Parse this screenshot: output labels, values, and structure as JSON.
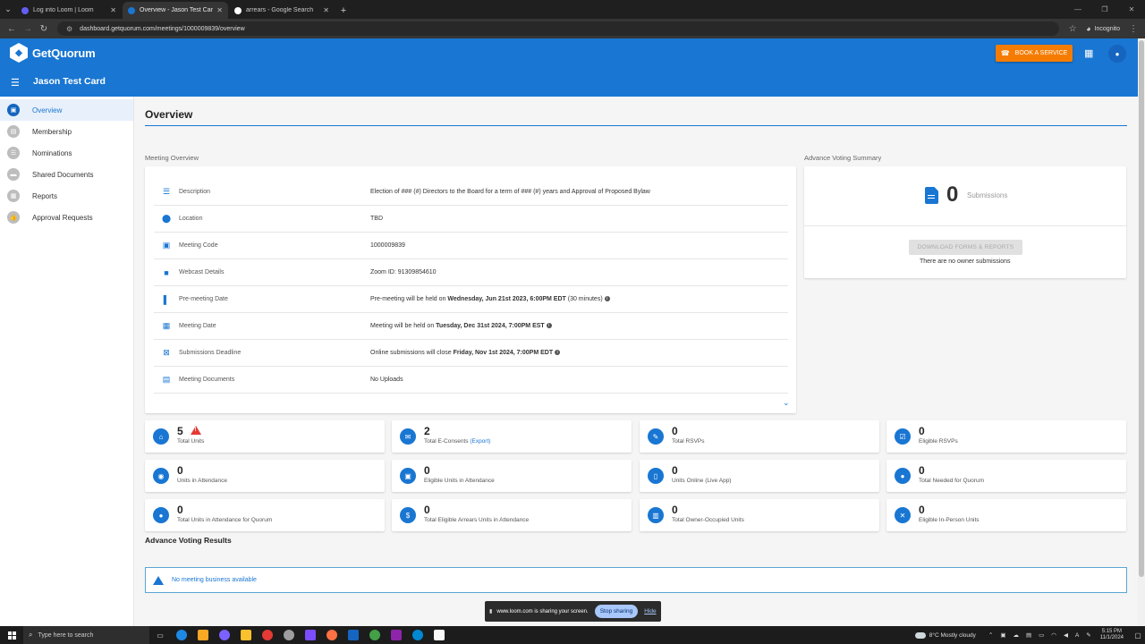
{
  "browser": {
    "tabs": [
      {
        "title": "Log into Loom | Loom",
        "active": false,
        "favicon_color": "#625df5"
      },
      {
        "title": "Overview - Jason Test Card",
        "active": true,
        "favicon_color": "#1976d2"
      },
      {
        "title": "arrears - Google Search",
        "active": false,
        "favicon_color": "#ffffff"
      }
    ],
    "new_tab": "+",
    "url": "dashboard.getquorum.com/meetings/1000009839/overview",
    "mode": "Incognito"
  },
  "header": {
    "brand": "GetQuorum",
    "meeting_name": "Jason Test Card",
    "book_service": "BOOK A SERVICE",
    "color": "#1976d2",
    "accent": "#f57c00"
  },
  "sidebar": {
    "items": [
      {
        "label": "Overview",
        "icon": "event-icon",
        "glyph": "▣",
        "active": true
      },
      {
        "label": "Membership",
        "icon": "members-icon",
        "glyph": "▤",
        "active": false
      },
      {
        "label": "Nominations",
        "icon": "nominations-icon",
        "glyph": "☰",
        "active": false
      },
      {
        "label": "Shared Documents",
        "icon": "folder-icon",
        "glyph": "▬",
        "active": false
      },
      {
        "label": "Reports",
        "icon": "reports-icon",
        "glyph": "▦",
        "active": false
      },
      {
        "label": "Approval Requests",
        "icon": "thumbs-up-icon",
        "glyph": "👍",
        "active": false
      }
    ]
  },
  "main": {
    "title": "Overview",
    "meeting_overview_label": "Meeting Overview",
    "advance_voting_label": "Advance Voting Summary",
    "overview_rows": [
      {
        "icon": "description-icon",
        "glyph": "☰",
        "label": "Description",
        "value": "Election of ### (#) Directors to the Board for a term of ### (#) years and Approval of Proposed Bylaw",
        "bold": "",
        "suffix": ""
      },
      {
        "icon": "location-icon",
        "glyph": "⬤",
        "label": "Location",
        "value": "TBD",
        "bold": "",
        "suffix": ""
      },
      {
        "icon": "meeting-code-icon",
        "glyph": "▣",
        "label": "Meeting Code",
        "value": "1000009839",
        "bold": "",
        "suffix": ""
      },
      {
        "icon": "webcast-icon",
        "glyph": "■",
        "label": "Webcast Details",
        "value": "Zoom ID: 91309854610",
        "bold": "",
        "suffix": ""
      },
      {
        "icon": "pre-meeting-icon",
        "glyph": "▌",
        "label": "Pre-meeting Date",
        "value": "Pre-meeting will be held on ",
        "bold": "Wednesday, Jun 21st 2023, 6:00PM EDT",
        "suffix": " (30 minutes)"
      },
      {
        "icon": "calendar-icon",
        "glyph": "▦",
        "label": "Meeting Date",
        "value": "Meeting will be held on ",
        "bold": "Tuesday, Dec 31st 2024, 7:00PM EST",
        "suffix": ""
      },
      {
        "icon": "deadline-icon",
        "glyph": "⊠",
        "label": "Submissions Deadline",
        "value": "Online submissions will close ",
        "bold": "Friday, Nov 1st 2024, 7:00PM EDT",
        "suffix": ""
      },
      {
        "icon": "pdf-icon",
        "glyph": "▤",
        "label": "Meeting Documents",
        "value": "No Uploads",
        "bold": "",
        "suffix": ""
      }
    ],
    "voting_summary": {
      "count": "0",
      "label": "Submissions",
      "download_button": "DOWNLOAD FORMS & REPORTS",
      "empty_text": "There are no owner submissions"
    },
    "stats": [
      {
        "num": "5",
        "label": "Total Units",
        "link": "",
        "icon": "home-icon",
        "glyph": "⌂",
        "warning": true
      },
      {
        "num": "2",
        "label": "Total E-Consents ",
        "link": "(Export)",
        "icon": "email-icon",
        "glyph": "✉",
        "warning": false
      },
      {
        "num": "0",
        "label": "Total RSVPs",
        "link": "",
        "icon": "rsvp-icon",
        "glyph": "✎",
        "warning": false
      },
      {
        "num": "0",
        "label": "Eligible RSVPs",
        "link": "",
        "icon": "eligible-rsvp-icon",
        "glyph": "☑",
        "warning": false
      },
      {
        "num": "0",
        "label": "Units in Attendance",
        "link": "",
        "icon": "pin-icon",
        "glyph": "◉",
        "warning": false
      },
      {
        "num": "0",
        "label": "Eligible Units in Attendance",
        "link": "",
        "icon": "ticket-icon",
        "glyph": "▣",
        "warning": false
      },
      {
        "num": "0",
        "label": "Units Online (Live App)",
        "link": "",
        "icon": "phone-icon",
        "glyph": "▯",
        "warning": false
      },
      {
        "num": "0",
        "label": "Total Needed for Quorum",
        "link": "",
        "icon": "group-icon",
        "glyph": "●",
        "warning": false
      },
      {
        "num": "0",
        "label": "Total Units in Attendance for Quorum",
        "link": "",
        "icon": "people-icon",
        "glyph": "●",
        "warning": false
      },
      {
        "num": "0",
        "label": "Total Eligible Arrears Units in Attendance",
        "link": "",
        "icon": "dollar-icon",
        "glyph": "$",
        "warning": false
      },
      {
        "num": "0",
        "label": "Total Owner-Occupied Units",
        "link": "",
        "icon": "building-icon",
        "glyph": "▥",
        "warning": false
      },
      {
        "num": "0",
        "label": "Eligible In-Person Units",
        "link": "",
        "icon": "block-icon",
        "glyph": "✕",
        "warning": false
      }
    ],
    "advance_voting_results": {
      "title": "Advance Voting Results",
      "message": "No meeting business available"
    }
  },
  "loom": {
    "message": "www.loom.com is sharing your screen.",
    "stop": "Stop sharing",
    "hide": "Hide"
  },
  "taskbar": {
    "search_placeholder": "Type here to search",
    "weather": "8°C  Mostly cloudy",
    "time": "5:15 PM",
    "date": "11/1/2024"
  }
}
